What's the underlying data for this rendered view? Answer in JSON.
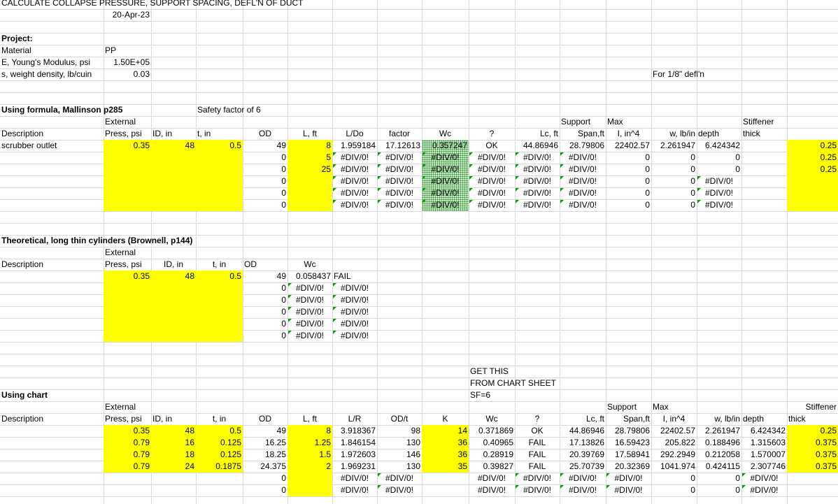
{
  "title": "CALCULATE COLLAPSE PRESSURE, SUPPORT SPACING, DEFL'N OF DUCT",
  "date": "20-Apr-23",
  "project": {
    "label": "Project:",
    "material_label": "Material",
    "material_value": "PP",
    "modulus_label": "E, Young's Modulus, psi",
    "modulus_value": "1.50E+05",
    "density_label": "s, weight density, lb/cuin",
    "density_value": "0.03",
    "defl_note": "For 1/8\" defl'n"
  },
  "section1": {
    "heading": "Using formula, Mallinson p285",
    "safety_note": "Safety factor of 6",
    "header_row1": {
      "external": "External",
      "support": "Support",
      "max": "Max",
      "stiffener": "Stiffener"
    },
    "header_row2": {
      "description": "Description",
      "press": "Press, psi",
      "id": "ID, in",
      "t": "t, in",
      "od": "OD",
      "l": "L, ft",
      "ldo": "L/Do",
      "factor": "factor",
      "wc": "Wc",
      "q": "?",
      "lc": "Lc, ft",
      "span": "Span,ft",
      "i": "I, in^4",
      "w": "w, lb/in",
      "depth": "depth",
      "thick": "thick"
    },
    "rows": [
      {
        "desc": "scrubber outlet",
        "press": "0.35",
        "id": "48",
        "t": "0.5",
        "od": "49",
        "l": "8",
        "ldo": "1.959184",
        "factor": "17.12613",
        "wc": "0.357247",
        "q": "OK",
        "lc": "44.86946",
        "span": "28.79806",
        "i": "22402.57",
        "w": "2.261947",
        "depth": "6.424342",
        "thick": "0.25"
      },
      {
        "desc": "",
        "press": "",
        "id": "",
        "t": "",
        "od": "0",
        "l": "5",
        "ldo": "#DIV/0!",
        "factor": "#DIV/0!",
        "wc": "#DIV/0!",
        "q": "#DIV/0!",
        "lc": "#DIV/0!",
        "span": "#DIV/0!",
        "i": "0",
        "w": "0",
        "depth": "0",
        "thick": "0.25"
      },
      {
        "desc": "",
        "press": "",
        "id": "",
        "t": "",
        "od": "0",
        "l": "25",
        "ldo": "#DIV/0!",
        "factor": "#DIV/0!",
        "wc": "#DIV/0!",
        "q": "#DIV/0!",
        "lc": "#DIV/0!",
        "span": "#DIV/0!",
        "i": "0",
        "w": "0",
        "depth": "0",
        "thick": "0.25"
      },
      {
        "desc": "",
        "press": "",
        "id": "",
        "t": "",
        "od": "0",
        "l": "",
        "ldo": "#DIV/0!",
        "factor": "#DIV/0!",
        "wc": "#DIV/0!",
        "q": "#DIV/0!",
        "lc": "#DIV/0!",
        "span": "#DIV/0!",
        "i": "0",
        "w": "0",
        "depth": "#DIV/0!",
        "thick": ""
      },
      {
        "desc": "",
        "press": "",
        "id": "",
        "t": "",
        "od": "0",
        "l": "",
        "ldo": "#DIV/0!",
        "factor": "#DIV/0!",
        "wc": "#DIV/0!",
        "q": "#DIV/0!",
        "lc": "#DIV/0!",
        "span": "#DIV/0!",
        "i": "0",
        "w": "0",
        "depth": "#DIV/0!",
        "thick": ""
      },
      {
        "desc": "",
        "press": "",
        "id": "",
        "t": "",
        "od": "0",
        "l": "",
        "ldo": "#DIV/0!",
        "factor": "#DIV/0!",
        "wc": "#DIV/0!",
        "q": "#DIV/0!",
        "lc": "#DIV/0!",
        "span": "#DIV/0!",
        "i": "0",
        "w": "0",
        "depth": "#DIV/0!",
        "thick": ""
      }
    ]
  },
  "section2": {
    "heading": "Theoretical, long thin cylinders (Brownell, p144)",
    "header_row1": {
      "external": "External"
    },
    "header_row2": {
      "description": "Description",
      "press": "Press, psi",
      "id": "ID, in",
      "t": "t, in",
      "od": "OD",
      "wc": "Wc"
    },
    "rows": [
      {
        "press": "0.35",
        "id": "48",
        "t": "0.5",
        "od": "49",
        "wc": "0.058437",
        "result": "FAIL"
      },
      {
        "press": "",
        "id": "",
        "t": "",
        "od": "0",
        "wc": "#DIV/0!",
        "result": "#DIV/0!"
      },
      {
        "press": "",
        "id": "",
        "t": "",
        "od": "0",
        "wc": "#DIV/0!",
        "result": "#DIV/0!"
      },
      {
        "press": "",
        "id": "",
        "t": "",
        "od": "0",
        "wc": "#DIV/0!",
        "result": "#DIV/0!"
      },
      {
        "press": "",
        "id": "",
        "t": "",
        "od": "0",
        "wc": "#DIV/0!",
        "result": "#DIV/0!"
      },
      {
        "press": "",
        "id": "",
        "t": "",
        "od": "0",
        "wc": "#DIV/0!",
        "result": "#DIV/0!"
      }
    ]
  },
  "section3": {
    "heading": "Using chart",
    "note1": "GET THIS",
    "note2": "FROM CHART SHEET",
    "note3": "SF=6",
    "header_row1": {
      "external": "External",
      "support": "Support",
      "max": "Max",
      "stiffener": "Stiffener"
    },
    "header_row2": {
      "description": "Description",
      "press": "Press, psi",
      "id": "ID, in",
      "t": "t, in",
      "od": "OD",
      "l": "L, ft",
      "lr": "L/R",
      "odt": "OD/t",
      "k": "K",
      "wc": "Wc",
      "q": "?",
      "lc": "Lc, ft",
      "span": "Span,ft",
      "i": "I, in^4",
      "w": "w, lb/in",
      "depth": "depth",
      "thick": "thick"
    },
    "rows": [
      {
        "press": "0.35",
        "id": "48",
        "t": "0.5",
        "od": "49",
        "l": "8",
        "lr": "3.918367",
        "odt": "98",
        "k": "14",
        "wc": "0.371869",
        "q": "OK",
        "lc": "44.86946",
        "span": "28.79806",
        "i": "22402.57",
        "w": "2.261947",
        "depth": "6.424342",
        "thick": "0.25"
      },
      {
        "press": "0.79",
        "id": "16",
        "t": "0.125",
        "od": "16.25",
        "l": "1.25",
        "lr": "1.846154",
        "odt": "130",
        "k": "36",
        "wc": "0.40965",
        "q": "FAIL",
        "lc": "17.13826",
        "span": "16.59423",
        "i": "205.822",
        "w": "0.188496",
        "depth": "1.315603",
        "thick": "0.375"
      },
      {
        "press": "0.79",
        "id": "18",
        "t": "0.125",
        "od": "18.25",
        "l": "1.5",
        "lr": "1.972603",
        "odt": "146",
        "k": "36",
        "wc": "0.28919",
        "q": "FAIL",
        "lc": "20.39769",
        "span": "17.58941",
        "i": "292.2949",
        "w": "0.212058",
        "depth": "1.570007",
        "thick": "0.375"
      },
      {
        "press": "0.79",
        "id": "24",
        "t": "0.1875",
        "od": "24.375",
        "l": "2",
        "lr": "1.969231",
        "odt": "130",
        "k": "35",
        "wc": "0.39827",
        "q": "FAIL",
        "lc": "25.70739",
        "span": "20.32369",
        "i": "1041.974",
        "w": "0.424115",
        "depth": "2.307746",
        "thick": "0.375"
      },
      {
        "press": "",
        "id": "",
        "t": "",
        "od": "0",
        "l": "",
        "lr": "#DIV/0!",
        "odt": "#DIV/0!",
        "k": "",
        "wc": "#DIV/0!",
        "q": "#DIV/0!",
        "lc": "#DIV/0!",
        "span": "#DIV/0!",
        "i": "0",
        "w": "0",
        "depth": "#DIV/0!",
        "thick": ""
      },
      {
        "press": "",
        "id": "",
        "t": "",
        "od": "0",
        "l": "",
        "lr": "#DIV/0!",
        "odt": "#DIV/0!",
        "k": "",
        "wc": "#DIV/0!",
        "q": "#DIV/0!",
        "lc": "#DIV/0!",
        "span": "#DIV/0!",
        "i": "0",
        "w": "0",
        "depth": "#DIV/0!",
        "thick": ""
      }
    ]
  }
}
